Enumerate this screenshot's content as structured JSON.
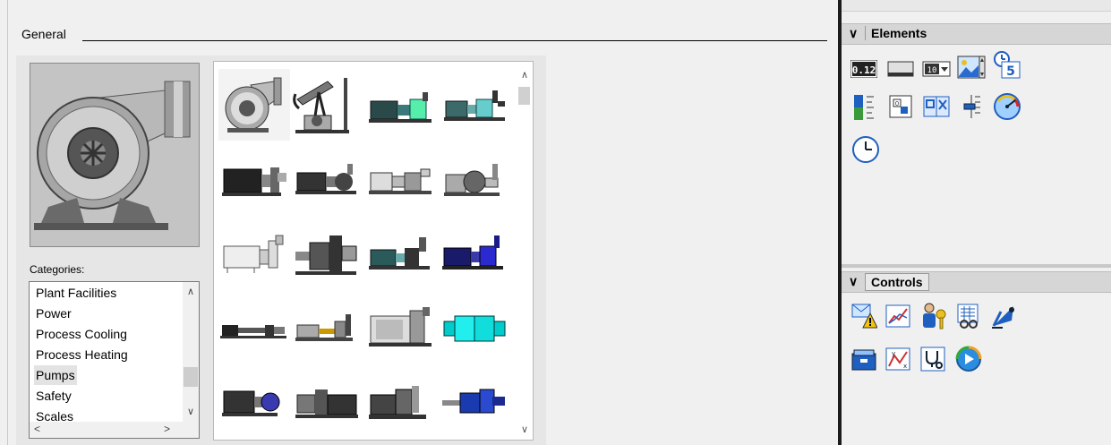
{
  "general": {
    "title": "General"
  },
  "categories": {
    "label": "Categories:",
    "items": [
      "Plant Facilities",
      "Power",
      "Process Cooling",
      "Process Heating",
      "Pumps",
      "Safety",
      "Scales"
    ],
    "selected": "Pumps"
  },
  "symbols": {
    "count": 20,
    "selected_index": 0,
    "icon_names": [
      "centrifugal-pump",
      "pumpjack",
      "horizontal-pump",
      "skid-pump",
      "motor-pump",
      "end-suction-pump",
      "gear-pump",
      "close-coupled-pump",
      "stainless-pump",
      "inline-pump",
      "packaged-pump",
      "blue-pump",
      "progressive-cavity-pump",
      "piston-pump",
      "large-pump",
      "cyan-pump",
      "motor-pump-2",
      "cylinder-pump",
      "base-pump",
      "blue-inline-pump"
    ]
  },
  "elements_section": {
    "title": "Elements",
    "items": [
      {
        "name": "io-field",
        "glyph": "0.12"
      },
      {
        "name": "button"
      },
      {
        "name": "symbolic-io-field",
        "glyph": "10"
      },
      {
        "name": "graphic-io-field"
      },
      {
        "name": "date-time-field",
        "glyph": "5"
      },
      {
        "name": "bar"
      },
      {
        "name": "switch"
      },
      {
        "name": "symbol-library"
      },
      {
        "name": "slider"
      },
      {
        "name": "gauge"
      },
      {
        "name": "clock"
      }
    ]
  },
  "controls_section": {
    "title": "Controls",
    "items": [
      {
        "name": "alarm-view"
      },
      {
        "name": "trend-view"
      },
      {
        "name": "user-view"
      },
      {
        "name": "recipe-view"
      },
      {
        "name": "system-diagnostics"
      },
      {
        "name": "sm-overview"
      },
      {
        "name": "f-x-trend-view"
      },
      {
        "name": "diagnostic-view"
      },
      {
        "name": "media-player"
      }
    ]
  },
  "colors": {
    "accent_blue": "#1f5fbf",
    "panel_bg": "#f0f0f0",
    "divider": "#1b1b1b"
  }
}
